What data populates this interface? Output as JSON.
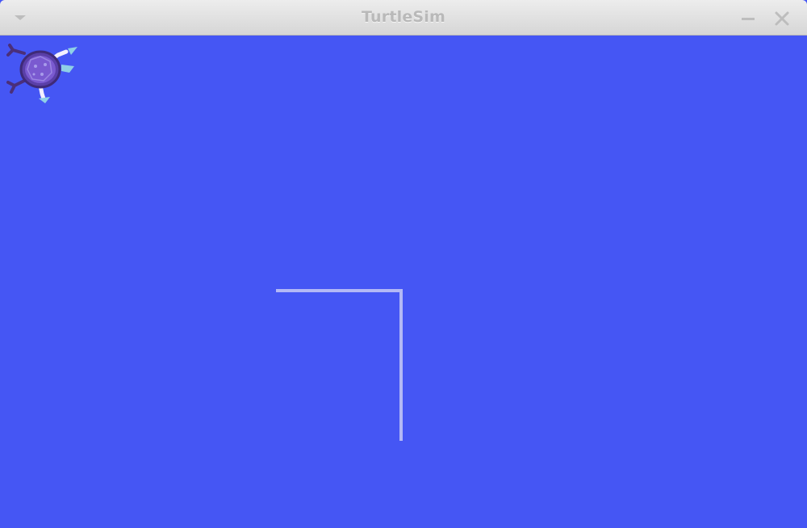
{
  "window": {
    "title": "TurtleSim"
  },
  "titlebar": {
    "menu_icon": "chevron-down-icon",
    "minimize_icon": "minimize-icon",
    "close_icon": "close-icon"
  },
  "canvas": {
    "background_color": "#4556f4",
    "pen_color": "#b3b8f6"
  },
  "turtle": {
    "icon": "turtle-icon",
    "shell_color": "#6a4fc0"
  }
}
